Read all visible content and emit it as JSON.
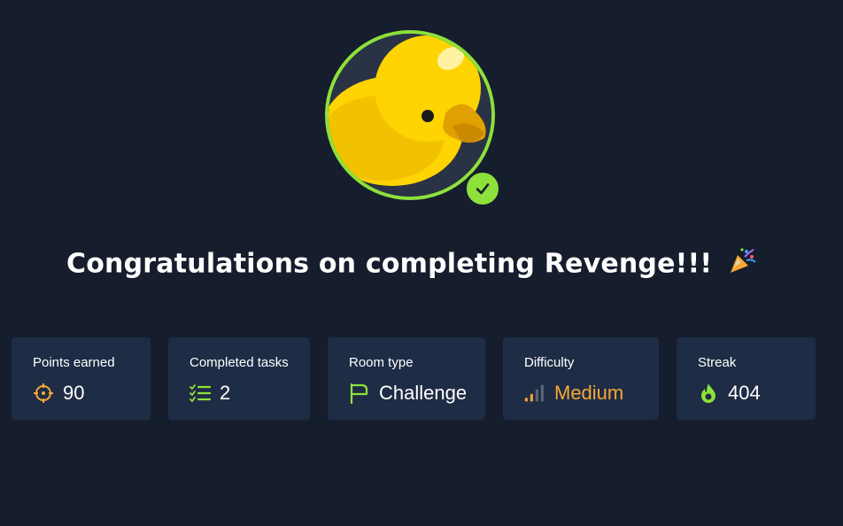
{
  "headline": {
    "text": "Congratulations on completing Revenge!!!",
    "emoji": "party-popper-icon"
  },
  "avatar": {
    "icon": "rubber-duck-icon",
    "status": "completed"
  },
  "colors": {
    "background": "#161d2c",
    "card": "#1f2c45",
    "accent_green": "#8ee03a",
    "accent_orange": "#f7a733"
  },
  "stats": [
    {
      "label": "Points earned",
      "value": "90",
      "icon": "crosshair-icon"
    },
    {
      "label": "Completed tasks",
      "value": "2",
      "icon": "checklist-icon"
    },
    {
      "label": "Room type",
      "value": "Challenge",
      "icon": "flag-icon"
    },
    {
      "label": "Difficulty",
      "value": "Medium",
      "icon": "signal-bars-icon"
    },
    {
      "label": "Streak",
      "value": "404",
      "icon": "flame-icon"
    }
  ]
}
